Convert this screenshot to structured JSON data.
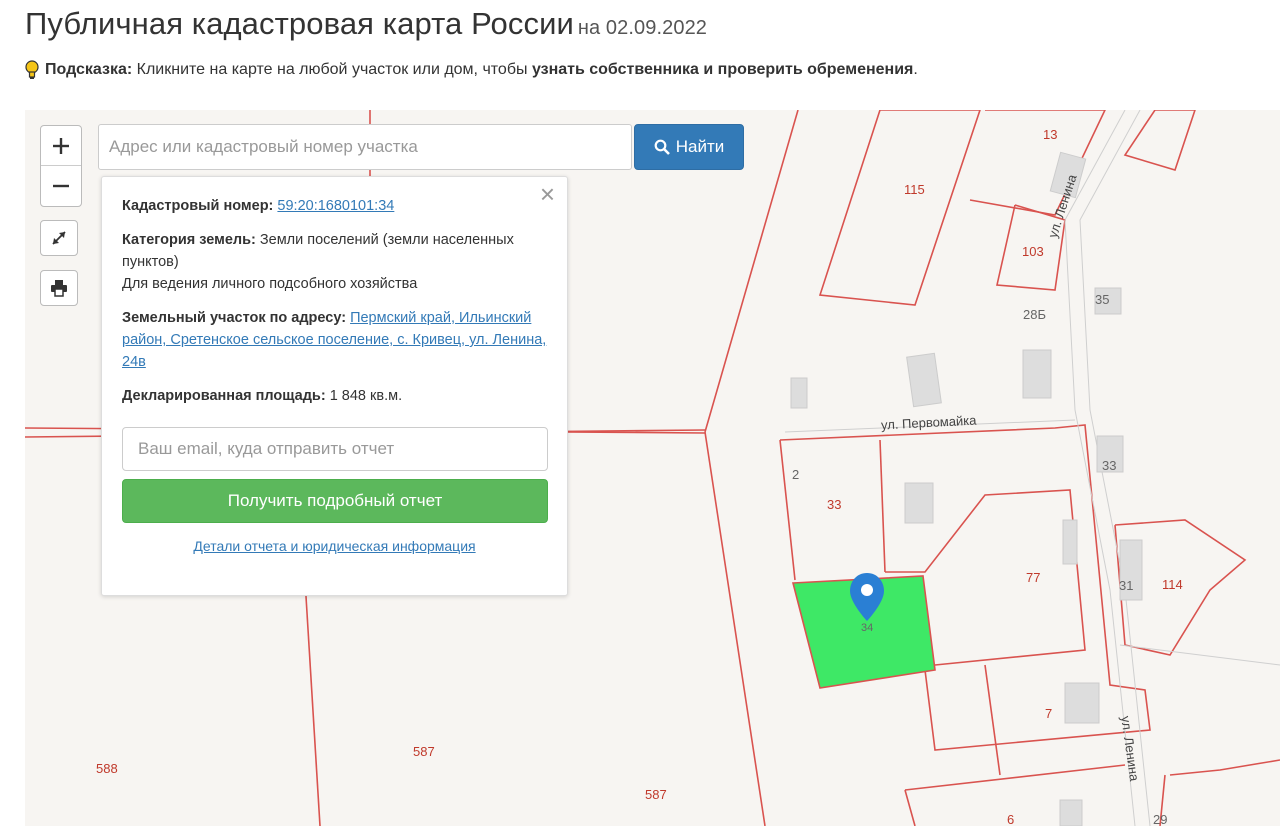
{
  "header": {
    "title": "Публичная кадастровая карта России",
    "date": "на 02.09.2022"
  },
  "hint": {
    "label": "Подсказка:",
    "text": " Кликните на карте на любой участок или дом, чтобы ",
    "bold": "узнать собственника и проверить обременения",
    "end": "."
  },
  "search": {
    "placeholder": "Адрес или кадастровый номер участка",
    "button_label": "Найти"
  },
  "popup": {
    "cadastral_label": "Кадастровый номер:",
    "cadastral_value": "59:20:1680101:34",
    "category_label": "Категория земель:",
    "category_value": " Земли поселений (земли населенных пунктов)",
    "usage": "Для ведения личного подсобного хозяйства",
    "address_label": "Земельный участок по адресу:",
    "address_value": "Пермский край, Ильинский район, Сретенское сельское поселение, с. Кривец, ул. Ленина, 24в",
    "area_label": "Декларированная площадь:",
    "area_value": " 1 848 кв.м.",
    "email_placeholder": "Ваш email, куда отправить отчет",
    "report_button": "Получить подробный отчет",
    "details_link": "Детали отчета и юридическая информация",
    "close": "×"
  },
  "map": {
    "labels": {
      "l115": "115",
      "l13": "13",
      "l103": "103",
      "l35": "35",
      "l28b": "28Б",
      "l33a": "33",
      "l33b": "33",
      "l2": "2",
      "l77": "77",
      "l31": "31",
      "l114": "114",
      "l34": "34",
      "l7": "7",
      "l588": "588",
      "l587a": "587",
      "l587b": "587",
      "l6": "6",
      "l29": "29"
    },
    "streets": {
      "pervomayka": "ул. Первомайка",
      "lenina_top": "ул. Ленина",
      "lenina_bottom": "ул. Ленина"
    },
    "colors": {
      "boundary": "#d9534f",
      "selected_parcel": "#3ee866",
      "marker": "#2a7fd4"
    }
  }
}
